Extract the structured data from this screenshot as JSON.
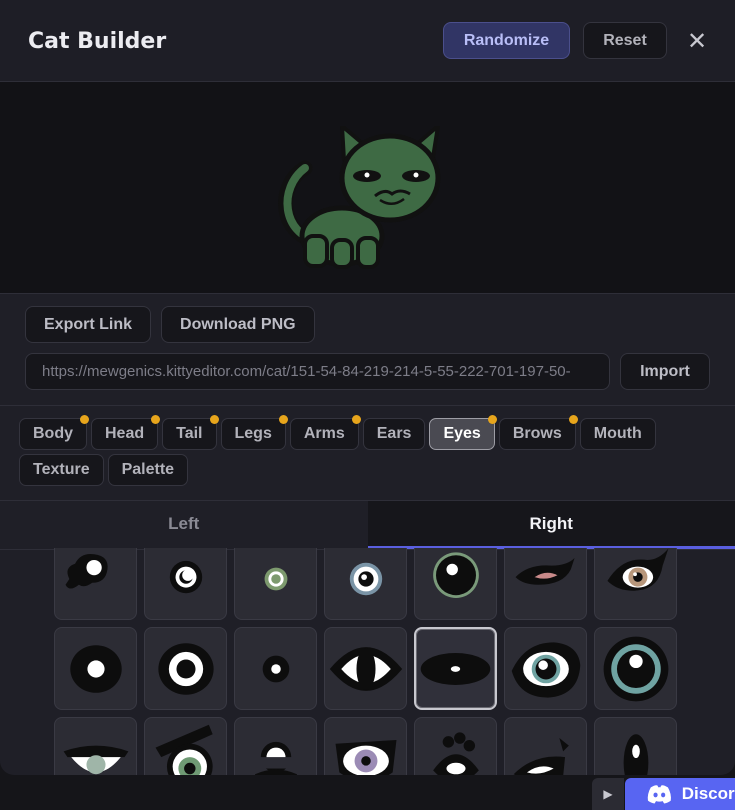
{
  "header": {
    "title": "Cat Builder",
    "randomize_label": "Randomize",
    "reset_label": "Reset",
    "close_symbol": "✕"
  },
  "preview": {
    "cat_color": "#3e6a44"
  },
  "actions": {
    "export_label": "Export Link",
    "download_label": "Download PNG",
    "url_value": "https://mewgenics.kittyeditor.com/cat/151-54-84-219-214-5-55-222-701-197-50-",
    "import_label": "Import"
  },
  "categories": [
    {
      "label": "Body",
      "dot": true
    },
    {
      "label": "Head",
      "dot": true
    },
    {
      "label": "Tail",
      "dot": true
    },
    {
      "label": "Legs",
      "dot": true
    },
    {
      "label": "Arms",
      "dot": true
    },
    {
      "label": "Ears",
      "dot": false
    },
    {
      "label": "Eyes",
      "dot": true,
      "active": true
    },
    {
      "label": "Brows",
      "dot": true
    },
    {
      "label": "Mouth",
      "dot": false
    },
    {
      "label": "Texture",
      "dot": false
    },
    {
      "label": "Palette",
      "dot": false
    }
  ],
  "tabs": {
    "left_label": "Left",
    "right_label": "Right",
    "active": "Right"
  },
  "eye_options": [
    "blob-eye-icon",
    "round-eye-icon",
    "small-green-ring-eye-icon",
    "blue-ring-eye-icon",
    "large-green-ring-eye-icon",
    "slit-pink-eye-icon",
    "tan-iris-eye-icon",
    "bold-dot-eye-icon",
    "ring-eye-icon",
    "tiny-dot-eye-icon",
    "almond-eye-icon",
    "oval-eye-icon",
    "teal-oval-eye-icon",
    "teal-round-eye-icon",
    "sleepy-eye-icon",
    "angry-green-eye-icon",
    "half-moon-eye-icon",
    "purple-iris-eye-icon",
    "lashes-eye-icon",
    "squint-eye-icon",
    "tall-eye-icon"
  ],
  "selected_eye": "oval-eye-icon",
  "discord": {
    "label": "Discord"
  }
}
